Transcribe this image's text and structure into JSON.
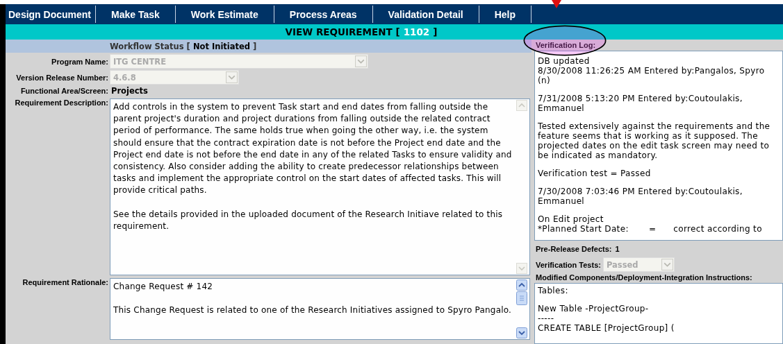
{
  "nav": [
    {
      "label": "Design Document"
    },
    {
      "label": "Make Task"
    },
    {
      "label": "Work Estimate"
    },
    {
      "label": "Process Areas"
    },
    {
      "label": "Validation Detail"
    },
    {
      "label": "Help"
    }
  ],
  "title": {
    "text": "VIEW REQUIREMENT [",
    "id": "1102",
    "close": "]"
  },
  "workflow": {
    "label": "Workflow Status [",
    "value": "Not Initiated",
    "close": "]"
  },
  "program_name": {
    "label": "Program Name:",
    "value": "ITG CENTRE",
    "disabled": true
  },
  "version": {
    "label": "Version Release Number:",
    "value": "4.6.8",
    "disabled": true
  },
  "functional_area": {
    "label": "Functional Area/Screen:",
    "value": "Projects"
  },
  "description": {
    "label": "Requirement Description:",
    "paragraphs": [
      "Add controls in the system to prevent Task start and end dates from falling outside the parent project's duration and project durations from falling outside the related contract period of performance. The same holds true when going the other way, i.e. the system should ensure that the contract expiration date is not before the Project end date and the Project end date is not before the end date in any of the related Tasks to ensure validity and consistency.  Also consider adding the ability to create predecessor relationships between tasks and implement the appropriate control on the start dates of affected tasks.  This will provide critical paths.",
      "See the details provided in the uploaded document  of the Research Initiave related to this requirement."
    ]
  },
  "rationale": {
    "label": "Requirement Rationale:",
    "paragraphs": [
      "Change Request # 142",
      "This Change Request is related to one of the Research Initiatives assigned to Spyro Pangalo."
    ]
  },
  "verification_log": {
    "label": "Verification Log:",
    "paragraphs": [
      "DB updated\n8/30/2008 11:26:25 AM Entered by:Pangalos, Spyro (n)",
      "7/31/2008 5:13:20 PM Entered by:Coutoulakis, Emmanuel",
      "Tested extensively against the requirements and the feature seems that is working as it supposed. The projected dates on the edit task screen may need to be indicated as mandatory.\n",
      "Verification test = Passed",
      "7/30/2008 7:03:46 PM Entered by:Coutoulakis, Emmanuel",
      "On Edit project\n*Planned Start Date:       =      correct according to"
    ]
  },
  "pre_release_defects": {
    "label": "Pre-Release Defects:",
    "value": "1"
  },
  "verification_tests": {
    "label": "Verification Tests:",
    "value": "Passed",
    "disabled": true
  },
  "modified_components": {
    "label": "Modified Components/Deployment-Integration Instructions:",
    "paragraphs": [
      "Tables:",
      "New Table -ProjectGroup-\n-----\nCREATE TABLE [ProjectGroup] ("
    ]
  }
}
